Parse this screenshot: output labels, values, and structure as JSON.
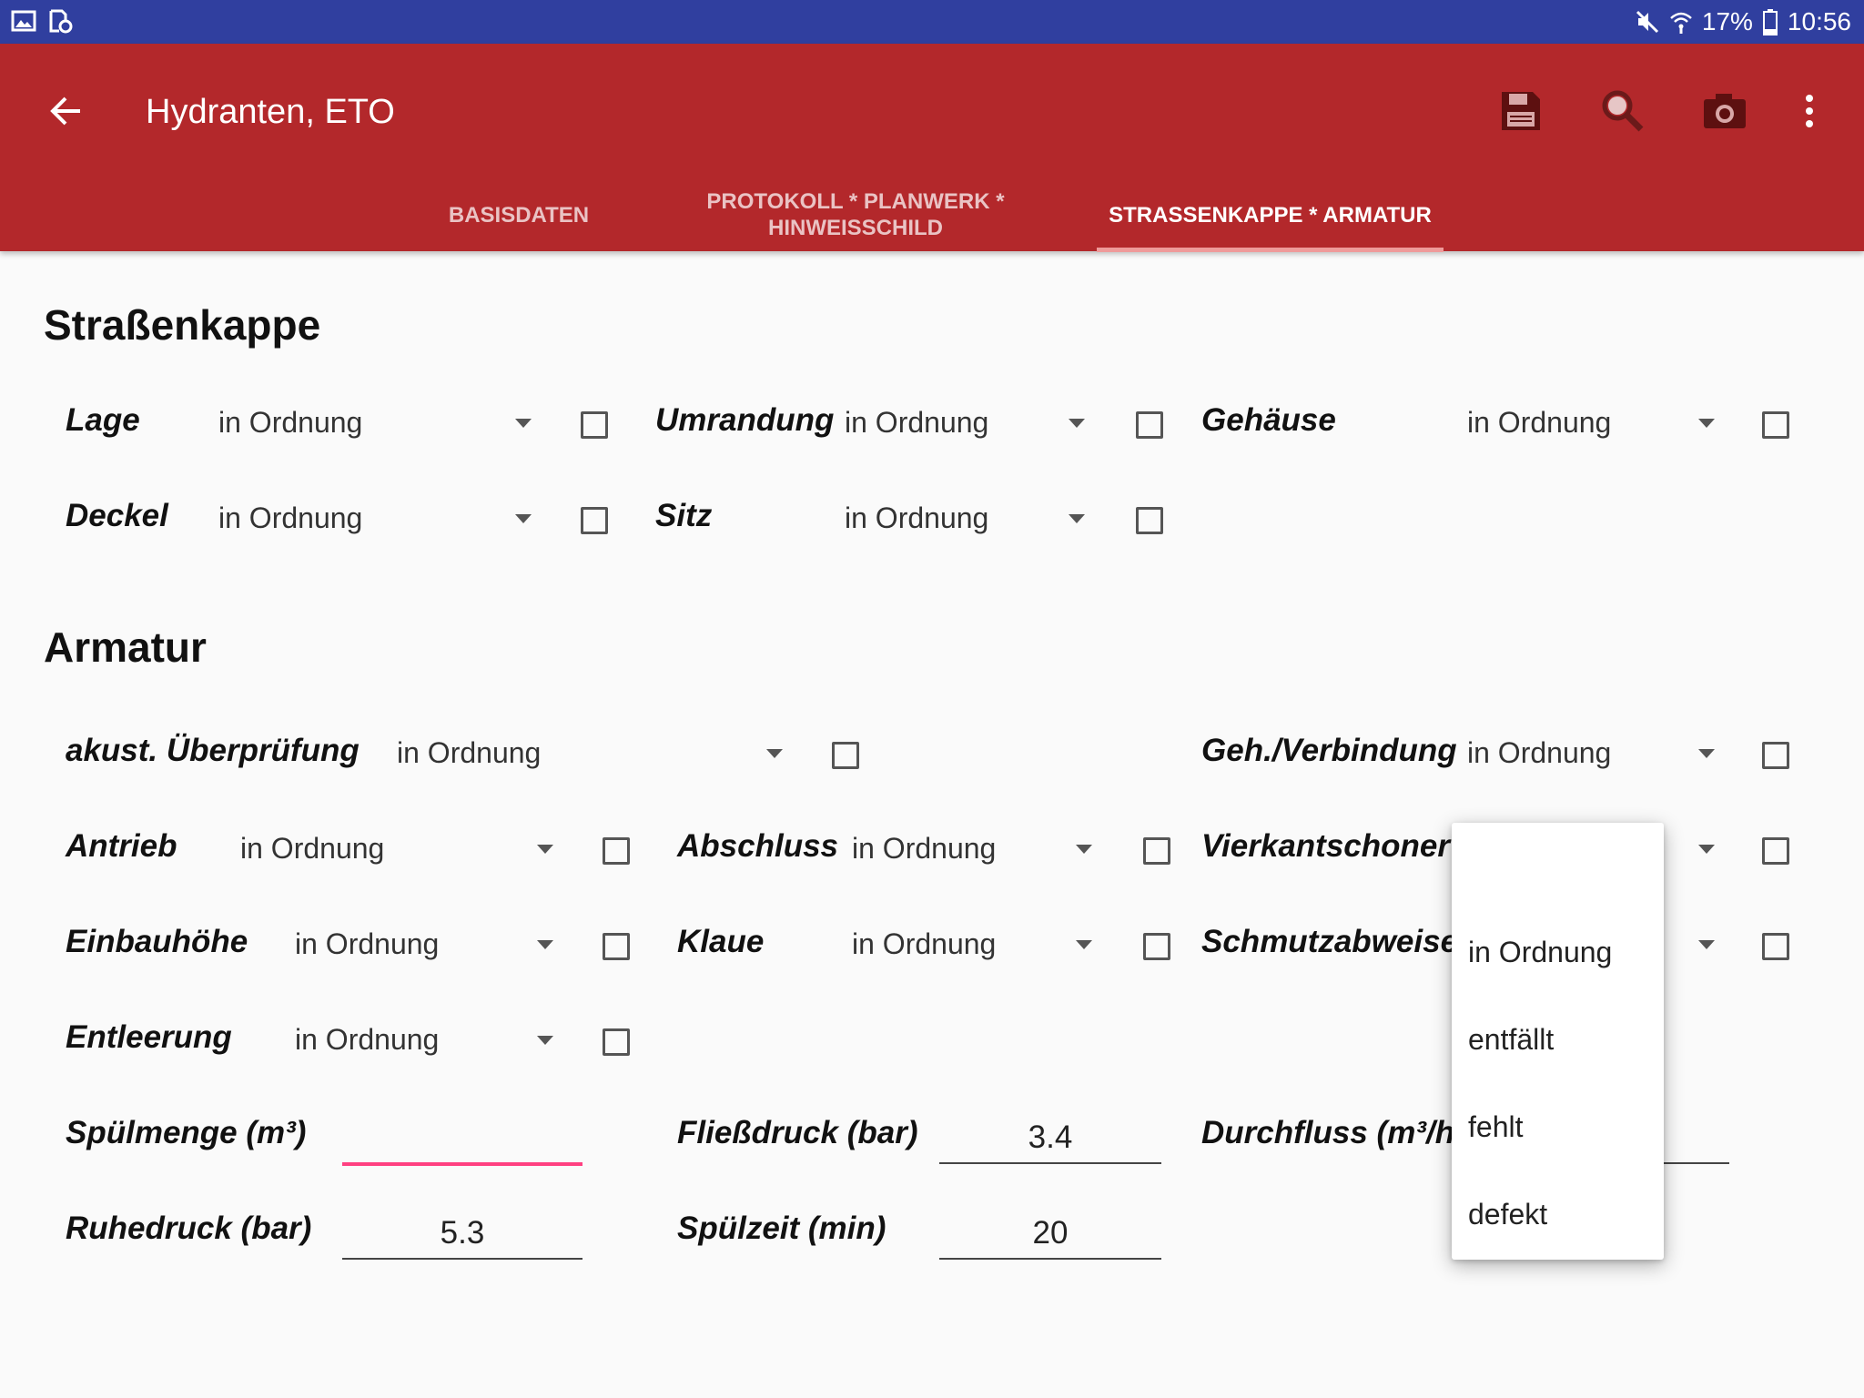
{
  "status_bar": {
    "battery": "17%",
    "time": "10:56",
    "icons": [
      "image-icon",
      "document-clock-icon",
      "mute-icon",
      "wifi-icon",
      "battery-icon"
    ]
  },
  "app_bar": {
    "title": "Hydranten, ETO",
    "actions": [
      "save-icon",
      "search-icon",
      "camera-icon",
      "more-vert-icon"
    ],
    "color": "#b3282b"
  },
  "tabs": [
    {
      "label": "BASISDATEN",
      "active": false
    },
    {
      "label_line1": "PROTOKOLL * PLANWERK *",
      "label_line2": "HINWEISSCHILD",
      "active": false
    },
    {
      "label": "STRASSENKAPPE * ARMATUR",
      "active": true
    }
  ],
  "section_strassenkappe": {
    "title": "Straßenkappe",
    "fields": [
      {
        "label": "Lage",
        "value": "in Ordnung"
      },
      {
        "label": "Umrandung",
        "value": "in Ordnung"
      },
      {
        "label": "Gehäuse",
        "value": "in Ordnung"
      },
      {
        "label": "Deckel",
        "value": "in Ordnung"
      },
      {
        "label": "Sitz",
        "value": "in Ordnung"
      }
    ]
  },
  "section_armatur": {
    "title": "Armatur",
    "fields": [
      {
        "label": "akust. Überprüfung",
        "value": "in Ordnung"
      },
      {
        "label": "Geh./Verbindung",
        "value": "in Ordnung"
      },
      {
        "label": "Antrieb",
        "value": "in Ordnung"
      },
      {
        "label": "Abschluss",
        "value": "in Ordnung"
      },
      {
        "label": "Vierkantschoner",
        "value": ""
      },
      {
        "label": "Einbauhöhe",
        "value": "in Ordnung"
      },
      {
        "label": "Klaue",
        "value": "in Ordnung"
      },
      {
        "label": "Schmutzabweiser",
        "value": ""
      },
      {
        "label": "Entleerung",
        "value": "in Ordnung"
      }
    ],
    "inputs": [
      {
        "label": "Spülmenge (m³)",
        "value": ""
      },
      {
        "label": "Fließdruck (bar)",
        "value": "3.4"
      },
      {
        "label": "Durchfluss (m³/h)",
        "value": ""
      },
      {
        "label": "Ruhedruck (bar)",
        "value": "5.3"
      },
      {
        "label": "Spülzeit (min)",
        "value": "20"
      }
    ]
  },
  "dropdown_popup": {
    "options": [
      "",
      "in Ordnung",
      "entfällt",
      "fehlt",
      "defekt"
    ]
  },
  "colors": {
    "status_bar": "#303f9f",
    "accent_focus": "#ff4081",
    "tab_indicator": "#ef9a9a"
  }
}
